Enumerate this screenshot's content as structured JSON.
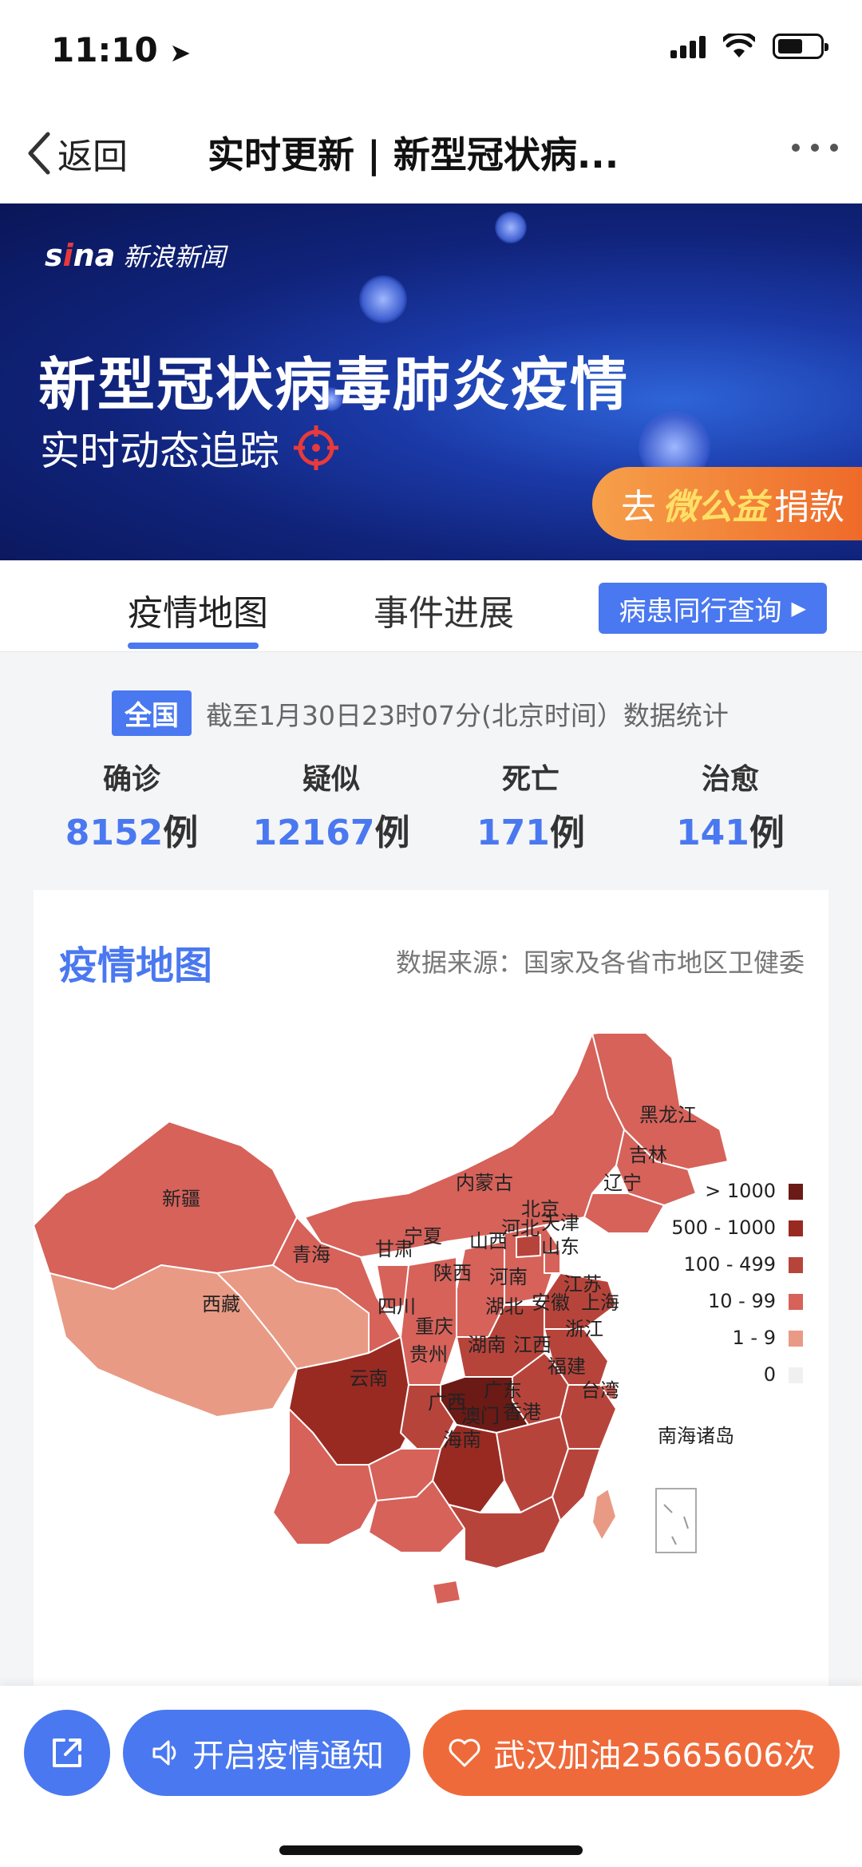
{
  "status_bar": {
    "time": "11:10"
  },
  "nav": {
    "back_label": "返回",
    "title": "实时更新 | 新型冠状病..."
  },
  "banner": {
    "logo_text": "新浪新闻",
    "title": "新型冠状病毒肺炎疫情",
    "subtitle": "实时动态追踪",
    "donate_prefix": "去",
    "donate_brand": "微公益",
    "donate_suffix": "捐款"
  },
  "tabs": [
    {
      "label": "疫情地图",
      "active": true
    },
    {
      "label": "事件进展",
      "active": false
    }
  ],
  "tab_pill": {
    "label": "病患同行查询"
  },
  "stats": {
    "scope": "全国",
    "date_text": "截至1月30日23时07分(北京时间）数据统计",
    "items": [
      {
        "label": "确诊",
        "value": "8152",
        "unit": "例"
      },
      {
        "label": "疑似",
        "value": "12167",
        "unit": "例"
      },
      {
        "label": "死亡",
        "value": "171",
        "unit": "例"
      },
      {
        "label": "治愈",
        "value": "141",
        "unit": "例"
      }
    ]
  },
  "map": {
    "title": "疫情地图",
    "source": "数据来源：国家及各省市地区卫健委",
    "legend": [
      {
        "label": "> 1000",
        "color": "#6b1a16"
      },
      {
        "label": "500 - 1000",
        "color": "#992a22"
      },
      {
        "label": "100 - 499",
        "color": "#b7443b"
      },
      {
        "label": "10 - 99",
        "color": "#d6625a"
      },
      {
        "label": "1 - 9",
        "color": "#e99a85"
      },
      {
        "label": "0",
        "color": "#f0f0f0"
      }
    ],
    "region_labels": {
      "heilongjiang": "黑龙江",
      "jilin": "吉林",
      "liaoning": "辽宁",
      "neimenggu": "内蒙古",
      "xinjiang": "新疆",
      "qinghai": "青海",
      "xizang": "西藏",
      "gansu": "甘肃",
      "ningxia": "宁夏",
      "beijing": "北京",
      "tianjin": "天津",
      "hebei": "河北",
      "shanxi": "山西",
      "shandong": "山东",
      "shaanxi": "陕西",
      "henan": "河南",
      "jiangsu": "江苏",
      "anhui": "安徽",
      "shanghai": "上海",
      "sichuan": "四川",
      "chongqing": "重庆",
      "hubei": "湖北",
      "zhejiang": "浙江",
      "guizhou": "贵州",
      "hunan": "湖南",
      "jiangxi": "江西",
      "fujian": "福建",
      "yunnan": "云南",
      "guangxi": "广西",
      "guangdong": "广东",
      "taiwan": "台湾",
      "aomen": "澳门",
      "xianggang": "香港",
      "hainan": "海南",
      "nanhai": "南海诸岛"
    }
  },
  "bottom": {
    "notify_label": "开启疫情通知",
    "cheer_label": "武汉加油25665606次"
  },
  "colors": {
    "accent": "#4a78f0",
    "cheer": "#ef6a3a"
  }
}
